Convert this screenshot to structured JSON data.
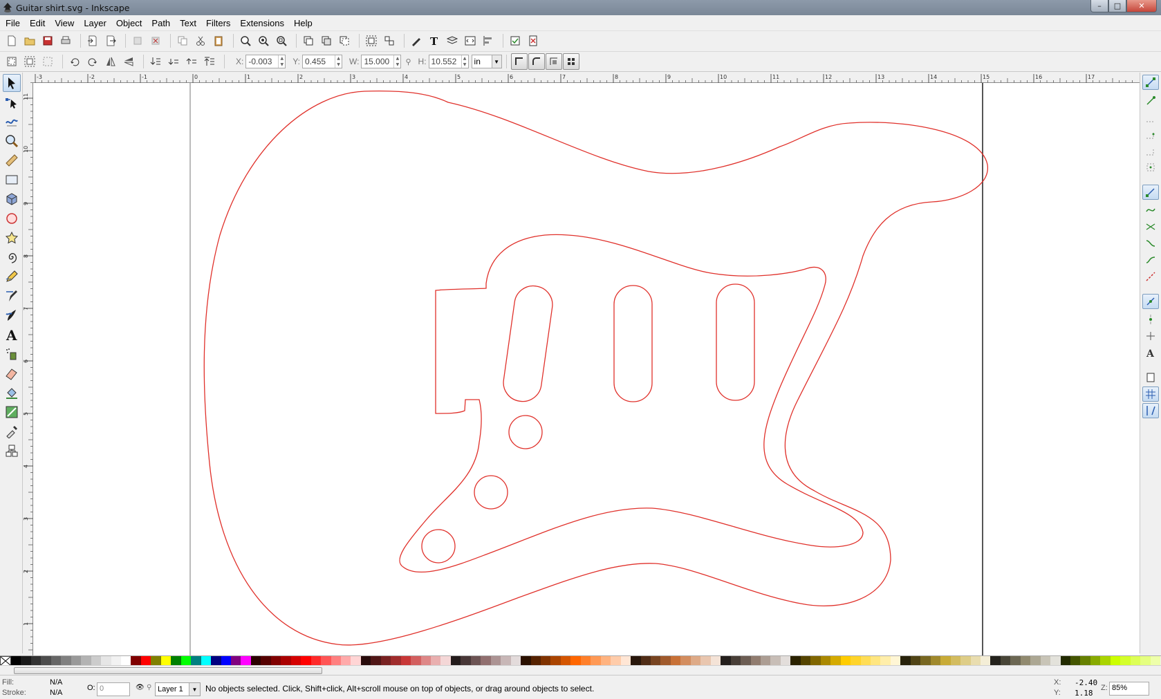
{
  "window": {
    "title": "Guitar shirt.svg - Inkscape"
  },
  "menu": [
    "File",
    "Edit",
    "View",
    "Layer",
    "Object",
    "Path",
    "Text",
    "Filters",
    "Extensions",
    "Help"
  ],
  "toolbar_xywh": {
    "x_label": "X:",
    "x_value": "-0.003",
    "y_label": "Y:",
    "y_value": "0.455",
    "w_label": "W:",
    "w_value": "15.000",
    "h_label": "H:",
    "h_value": "10.552",
    "unit": "in"
  },
  "ruler": {
    "h_labels": [
      "-3",
      "-2",
      "-1",
      "0",
      "1",
      "2",
      "3",
      "4",
      "5",
      "6",
      "7",
      "8",
      "9",
      "10",
      "11",
      "12",
      "13",
      "14",
      "15",
      "16",
      "17"
    ],
    "v_labels": [
      "11",
      "10",
      "9",
      "8",
      "7",
      "6",
      "5",
      "4",
      "3",
      "2",
      "1"
    ]
  },
  "canvas": {
    "stroke_color": "#e0302a"
  },
  "status": {
    "fill_label": "Fill:",
    "fill_value": "N/A",
    "stroke_label": "Stroke:",
    "stroke_value": "N/A",
    "opacity_label": "O:",
    "opacity_value": "0",
    "layer": "Layer 1",
    "message": "No objects selected. Click, Shift+click, Alt+scroll mouse on top of objects, or drag around objects to select.",
    "cursor_x_label": "X:",
    "cursor_x": "-2.40",
    "cursor_y_label": "Y:",
    "cursor_y": "1.18",
    "zoom_label": "Z:",
    "zoom": "85%"
  },
  "palette_colors": [
    "#000000",
    "#1a1a1a",
    "#333333",
    "#4d4d4d",
    "#666666",
    "#808080",
    "#999999",
    "#b3b3b3",
    "#cccccc",
    "#e6e6e6",
    "#f2f2f2",
    "#ffffff",
    "#800000",
    "#ff0000",
    "#808000",
    "#ffff00",
    "#008000",
    "#00ff00",
    "#008080",
    "#00ffff",
    "#000080",
    "#0000ff",
    "#800080",
    "#ff00ff",
    "#2b0000",
    "#550000",
    "#800000",
    "#aa0000",
    "#d40000",
    "#ff0000",
    "#ff2a2a",
    "#ff5555",
    "#ff8080",
    "#ffaaaa",
    "#ffd5d5",
    "#280b0b",
    "#501616",
    "#782121",
    "#a02c2c",
    "#c83737",
    "#d35f5f",
    "#de8787",
    "#e9afaf",
    "#f4d7d7",
    "#241c1c",
    "#483737",
    "#6c5353",
    "#916f6f",
    "#ac9393",
    "#c8b7b7",
    "#e3dbdb",
    "#2b1100",
    "#552200",
    "#803300",
    "#aa4400",
    "#d45500",
    "#ff6600",
    "#ff7f2a",
    "#ff9955",
    "#ffb380",
    "#ffccaa",
    "#ffe6d5",
    "#28170b",
    "#502d16",
    "#784421",
    "#a05a2c",
    "#c87137",
    "#d38d5f",
    "#deaa87",
    "#e9c6af",
    "#f4e3d7",
    "#241f1c",
    "#483e37",
    "#6c5d53",
    "#917c6f",
    "#ac9d93",
    "#c8beb7",
    "#e3dedb",
    "#2b2200",
    "#554400",
    "#806600",
    "#aa8800",
    "#d4aa00",
    "#ffcc00",
    "#ffd42a",
    "#ffdd55",
    "#ffe680",
    "#ffeeaa",
    "#fff6d5",
    "#28220b",
    "#504416",
    "#786721",
    "#a0892c",
    "#c8ab37",
    "#d3bc5f",
    "#decd87",
    "#e9ddaf",
    "#f4eed7",
    "#24221c",
    "#484537",
    "#6c6753",
    "#918a6f",
    "#aca793",
    "#c8c4b7",
    "#e3e2db",
    "#222b00",
    "#445500",
    "#668000",
    "#88aa00",
    "#aad400",
    "#ccff00",
    "#d4ff2a",
    "#ddff55",
    "#e5ff80",
    "#eeffaa"
  ]
}
